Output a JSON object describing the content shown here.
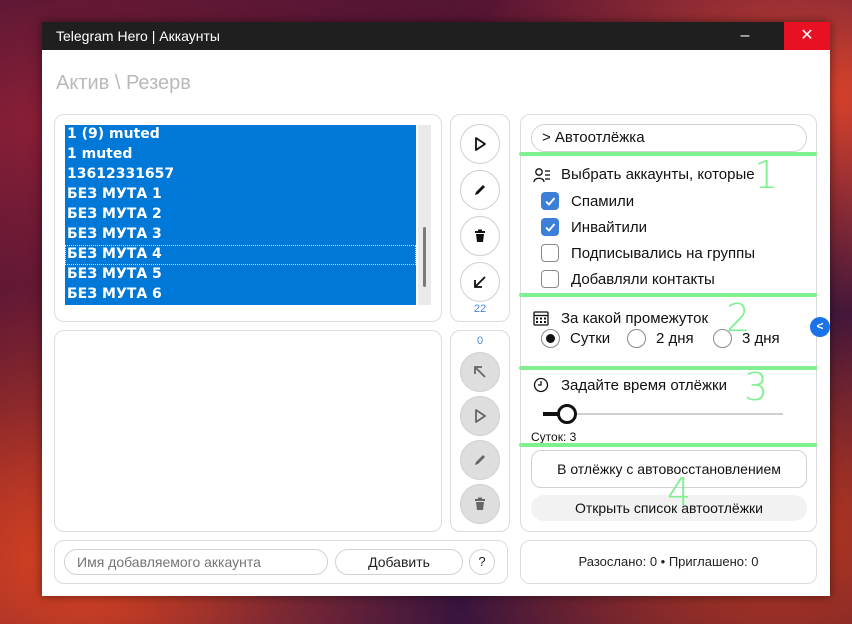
{
  "window": {
    "title": "Telegram Hero | Аккаунты",
    "minimize_glyph": "–",
    "close_glyph": "✕"
  },
  "breadcrumb": "Актив \\ Резерв",
  "accounts": {
    "items": [
      "1 (9) muted",
      "1 muted",
      "13612331657",
      "БЕЗ МУТА 1",
      "БЕЗ МУТА 2",
      "БЕЗ МУТА 3",
      "БЕЗ МУТА 4",
      "БЕЗ МУТА 5",
      "БЕЗ МУТА 6"
    ],
    "count": "22"
  },
  "reserve": {
    "count": "0"
  },
  "tools": {
    "top": [
      "play-icon",
      "pencil-icon",
      "trash-icon",
      "arrow-down-left-icon"
    ],
    "bottom": [
      "arrow-up-left-icon",
      "play-icon",
      "pencil-icon",
      "trash-icon"
    ]
  },
  "add_account": {
    "placeholder": "Имя добавляемого аккаунта",
    "button": "Добавить",
    "help": "?"
  },
  "autorest": {
    "header": "> Автоотлёжка",
    "select_label": "Выбрать аккаунты, которые",
    "options": [
      {
        "label": "Спамили",
        "checked": true
      },
      {
        "label": "Инвайтили",
        "checked": true
      },
      {
        "label": "Подписывались на группы",
        "checked": false
      },
      {
        "label": "Добавляли контакты",
        "checked": false
      }
    ],
    "period_label": "За какой промежуток",
    "periods": [
      {
        "label": "Сутки",
        "selected": true
      },
      {
        "label": "2 дня",
        "selected": false
      },
      {
        "label": "3 дня",
        "selected": false
      }
    ],
    "time_label": "Задайте время отлёжки",
    "slider_fraction": 0.1,
    "days_text": "Суток: 3",
    "primary_button": "В отлёжку с автовосстановлением",
    "open_list_button": "Открыть список автоотлёжки"
  },
  "annotations": [
    "1",
    "2",
    "3",
    "4"
  ],
  "stats": "Разослано: 0 • Приглашено: 0",
  "side_tab": "<",
  "colors": {
    "selection": "#0078d7",
    "accent": "#3b7fd9",
    "annotation": "#7ef08f",
    "close": "#e81123"
  }
}
